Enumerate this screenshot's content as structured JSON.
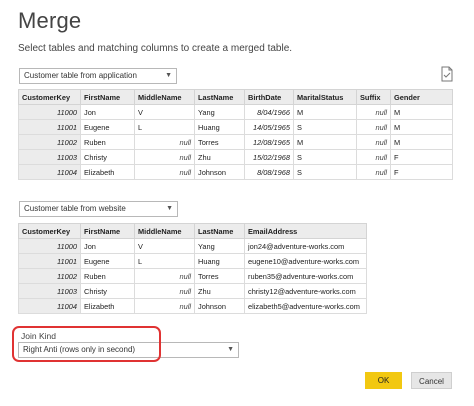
{
  "dialog": {
    "title": "Merge",
    "subtitle": "Select tables and matching columns to create a merged table."
  },
  "table1": {
    "dropdown": "Customer table from application",
    "columns": [
      "CustomerKey",
      "FirstName",
      "MiddleName",
      "LastName",
      "BirthDate",
      "MaritalStatus",
      "Suffix",
      "Gender"
    ],
    "rows": [
      {
        "key": "11000",
        "first": "Jon",
        "middle": "V",
        "last": "Yang",
        "birth": "8/04/1966",
        "marital": "M",
        "suffix": "null",
        "gender": "M"
      },
      {
        "key": "11001",
        "first": "Eugene",
        "middle": "L",
        "last": "Huang",
        "birth": "14/05/1965",
        "marital": "S",
        "suffix": "null",
        "gender": "M"
      },
      {
        "key": "11002",
        "first": "Ruben",
        "middle": "null",
        "last": "Torres",
        "birth": "12/08/1965",
        "marital": "M",
        "suffix": "null",
        "gender": "M"
      },
      {
        "key": "11003",
        "first": "Christy",
        "middle": "null",
        "last": "Zhu",
        "birth": "15/02/1968",
        "marital": "S",
        "suffix": "null",
        "gender": "F"
      },
      {
        "key": "11004",
        "first": "Elizabeth",
        "middle": "null",
        "last": "Johnson",
        "birth": "8/08/1968",
        "marital": "S",
        "suffix": "null",
        "gender": "F"
      }
    ]
  },
  "table2": {
    "dropdown": "Customer table from website",
    "columns": [
      "CustomerKey",
      "FirstName",
      "MiddleName",
      "LastName",
      "EmailAddress"
    ],
    "rows": [
      {
        "key": "11000",
        "first": "Jon",
        "middle": "V",
        "last": "Yang",
        "email": "jon24@adventure-works.com"
      },
      {
        "key": "11001",
        "first": "Eugene",
        "middle": "L",
        "last": "Huang",
        "email": "eugene10@adventure-works.com"
      },
      {
        "key": "11002",
        "first": "Ruben",
        "middle": "null",
        "last": "Torres",
        "email": "ruben35@adventure-works.com"
      },
      {
        "key": "11003",
        "first": "Christy",
        "middle": "null",
        "last": "Zhu",
        "email": "christy12@adventure-works.com"
      },
      {
        "key": "11004",
        "first": "Elizabeth",
        "middle": "null",
        "last": "Johnson",
        "email": "elizabeth5@adventure-works.com"
      }
    ]
  },
  "join": {
    "label": "Join Kind",
    "selected": "Right Anti (rows only in second)"
  },
  "buttons": {
    "ok": "OK",
    "cancel": "Cancel"
  },
  "colors": {
    "ok_button": "#f2c811",
    "highlight": "#e03333"
  },
  "icons": {
    "dropdown_arrow": "chevron-down-icon",
    "document": "document-icon"
  }
}
